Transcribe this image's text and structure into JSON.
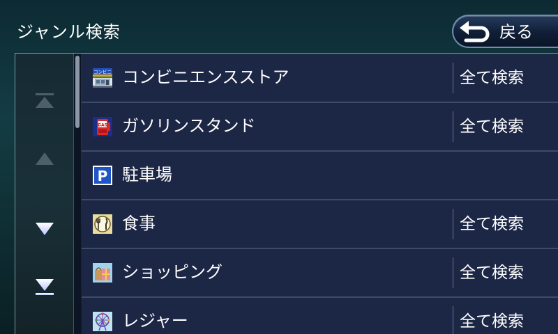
{
  "header": {
    "title": "ジャンル検索",
    "back_label": "戻る"
  },
  "side_nav": {
    "buttons": [
      "scroll-top",
      "page-up",
      "page-down",
      "scroll-bottom"
    ]
  },
  "list": {
    "items": [
      {
        "label": "コンビニエンスストア",
        "icon": "convenience-store-icon",
        "icon_text": "コンビニ",
        "action": "全て検索"
      },
      {
        "label": "ガソリンスタンド",
        "icon": "gas-station-icon",
        "icon_text": "GAS",
        "action": "全て検索"
      },
      {
        "label": "駐車場",
        "icon": "parking-icon",
        "icon_text": "P",
        "action": ""
      },
      {
        "label": "食事",
        "icon": "restaurant-icon",
        "action": "全て検索"
      },
      {
        "label": "ショッピング",
        "icon": "shopping-icon",
        "action": "全て検索"
      },
      {
        "label": "レジャー",
        "icon": "leisure-icon",
        "action": "全て検索"
      }
    ]
  },
  "colors": {
    "row_background": "#1c2645",
    "row_separator": "#3d4b6a",
    "text": "#ffffff"
  }
}
